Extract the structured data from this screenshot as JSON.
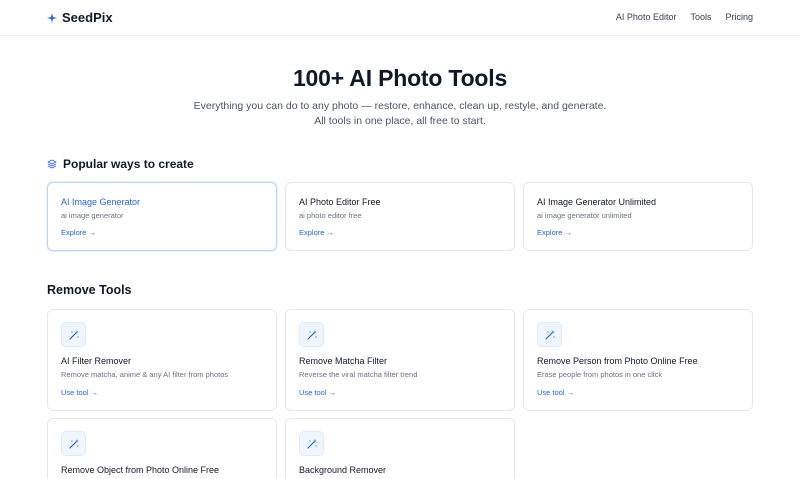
{
  "nav": {
    "brand": "SeedPix",
    "links": [
      "AI Photo Editor",
      "Tools",
      "Pricing"
    ]
  },
  "hero": {
    "title": "100+ AI Photo Tools",
    "subtitle": "Everything you can do to any photo — restore, enhance, clean up, restyle, and generate. All tools in one place, all free to start."
  },
  "popular": {
    "title": "Popular ways to create",
    "cards": [
      {
        "title": "AI Image Generator",
        "subtitle": "ai image generator",
        "link": "Explore →"
      },
      {
        "title": "AI Photo Editor Free",
        "subtitle": "ai photo editor free",
        "link": "Explore →"
      },
      {
        "title": "AI Image Generator Unlimited",
        "subtitle": "ai image generator unlimited",
        "link": "Explore →"
      }
    ]
  },
  "remove": {
    "title": "Remove Tools",
    "cards": [
      {
        "title": "AI Filter Remover",
        "subtitle": "Remove matcha, anime & any AI filter from photos",
        "link": "Use tool →"
      },
      {
        "title": "Remove Matcha Filter",
        "subtitle": "Reverse the viral matcha filter trend",
        "link": "Use tool →"
      },
      {
        "title": "Remove Person from Photo Online Free",
        "subtitle": "Erase people from photos in one click",
        "link": "Use tool →"
      },
      {
        "title": "Remove Object from Photo Online Free"
      },
      {
        "title": "Background Remover"
      }
    ]
  },
  "colors": {
    "accent": "#2563eb",
    "icon_bg": "#eff6ff"
  },
  "icons": {
    "brand": "sparkle-icon",
    "section": "layers-icon",
    "tool": "magic-wand-icon"
  }
}
